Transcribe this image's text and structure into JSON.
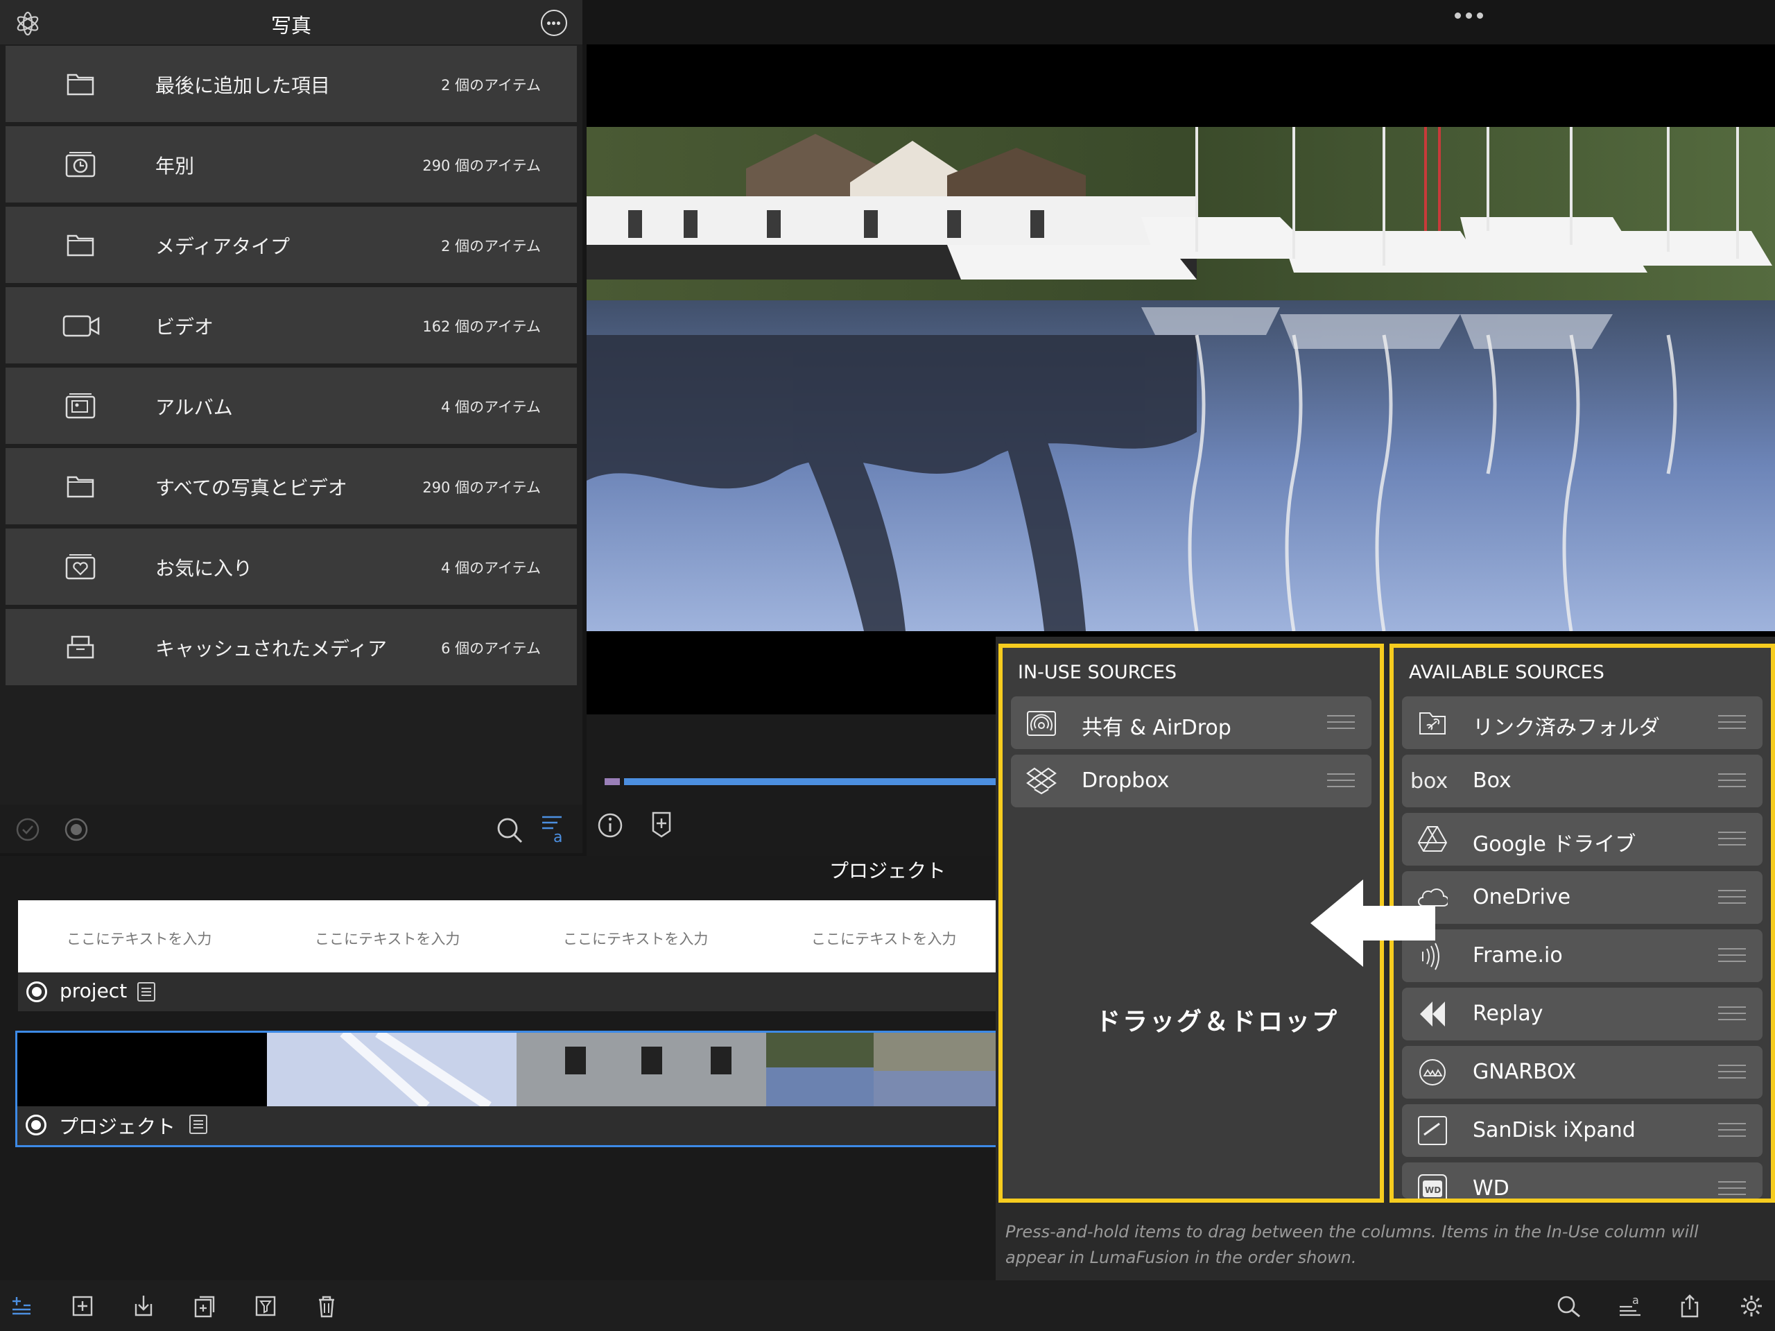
{
  "library": {
    "title": "写真",
    "items": [
      {
        "label": "最後に追加した項目",
        "count": "2 個のアイテム",
        "icon": "folder-icon"
      },
      {
        "label": "年別",
        "count": "290 個のアイテム",
        "icon": "clock-folder-icon"
      },
      {
        "label": "メディアタイプ",
        "count": "2 個のアイテム",
        "icon": "folder-icon"
      },
      {
        "label": "ビデオ",
        "count": "162 個のアイテム",
        "icon": "video-camera-icon"
      },
      {
        "label": "アルバム",
        "count": "4 個のアイテム",
        "icon": "album-icon"
      },
      {
        "label": "すべての写真とビデオ",
        "count": "290 個のアイテム",
        "icon": "folder-icon"
      },
      {
        "label": "お気に入り",
        "count": "4 個のアイテム",
        "icon": "heart-folder-icon"
      },
      {
        "label": "キャッシュされたメディア",
        "count": "6 個のアイテム",
        "icon": "cache-icon"
      }
    ]
  },
  "timeline": {
    "title": "プロジェクト",
    "title_placeholders": [
      "ここにテキストを入力",
      "ここにテキストを入力",
      "ここにテキストを入力",
      "ここにテキストを入力"
    ],
    "tracks": [
      {
        "name": "project"
      },
      {
        "name": "プロジェクト"
      }
    ]
  },
  "sources": {
    "in_use_title": "IN-USE SOURCES",
    "available_title": "AVAILABLE SOURCES",
    "in_use": [
      {
        "label": "共有 & AirDrop",
        "icon": "airdrop-folder-icon"
      },
      {
        "label": "Dropbox",
        "icon": "dropbox-icon"
      }
    ],
    "available": [
      {
        "label": "リンク済みフォルダ",
        "icon": "linked-folder-icon"
      },
      {
        "label": "Box",
        "icon": "box-icon"
      },
      {
        "label": "Google ドライブ",
        "icon": "google-drive-icon"
      },
      {
        "label": "OneDrive",
        "icon": "onedrive-icon"
      },
      {
        "label": "Frame.io",
        "icon": "frameio-icon"
      },
      {
        "label": "Replay",
        "icon": "replay-icon"
      },
      {
        "label": "GNARBOX",
        "icon": "gnarbox-icon"
      },
      {
        "label": "SanDisk iXpand",
        "icon": "sandisk-icon"
      },
      {
        "label": "WD",
        "icon": "wd-icon"
      }
    ],
    "hint": "Press-and-hold items to drag between the columns. Items in the In-Use column will appear in LumaFusion in the order shown.",
    "annotation": "ドラッグ＆ドロップ",
    "highlight_color": "#f6cc1f"
  },
  "colors": {
    "accent": "#3d8ae6",
    "row_bg": "#3a3a3a"
  }
}
